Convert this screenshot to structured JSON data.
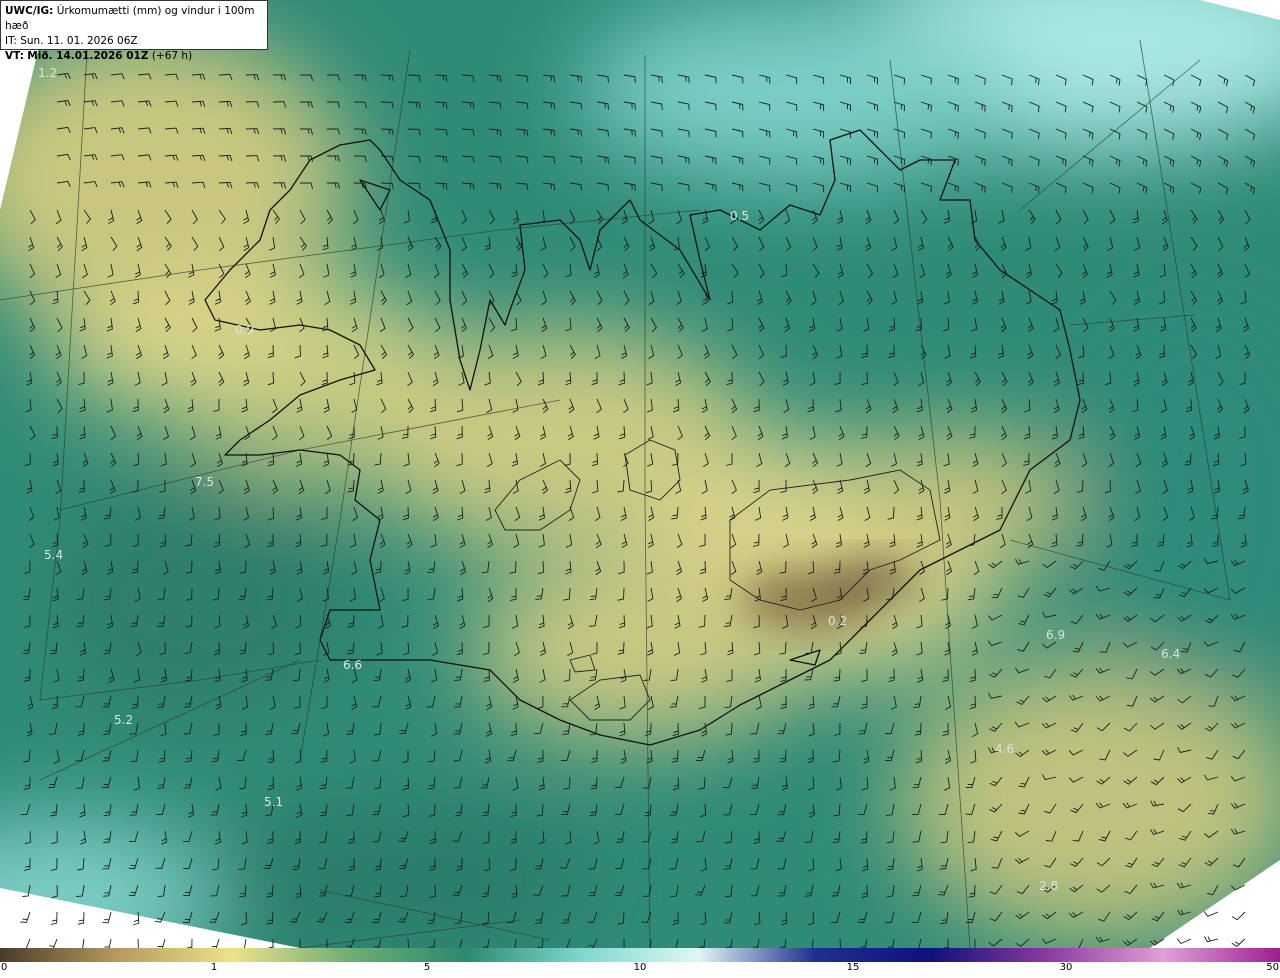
{
  "header": {
    "prefix": "UWC/IG:",
    "title": "Úrkomumætti (mm) og vindur i 100m hæð",
    "initial_time": "IT: Sun. 11. 01. 2026 06Z",
    "valid_prefix": "VT:",
    "valid_time": "Mið. 14.01.2026 01Z",
    "lead": "(+67 h)"
  },
  "colorbar": {
    "ticks": [
      "0",
      "1",
      "5",
      "10",
      "15",
      "30",
      "50"
    ],
    "colors": [
      "#4a3b2a",
      "#b59a5c",
      "#ede28a",
      "#6fae74",
      "#2a8a70",
      "#7ed8cf",
      "#dff7f5",
      "#203090",
      "#10107a",
      "#8a3aa0",
      "#e0a0d8",
      "#9b1f8f"
    ]
  },
  "value_labels": [
    "1.2",
    "0.5",
    "0.9",
    "7.5",
    "5.4",
    "6.6",
    "5.2",
    "5.1",
    "0.2",
    "6.9",
    "6.4",
    "4.6",
    "2.8"
  ]
}
